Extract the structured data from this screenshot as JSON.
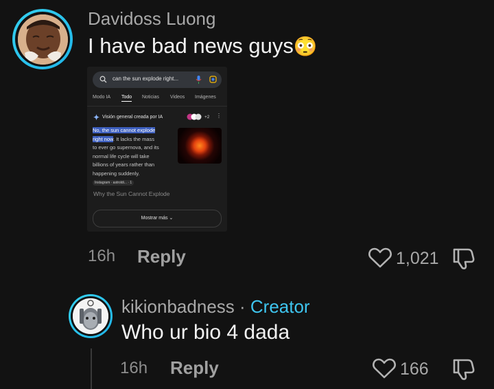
{
  "comment": {
    "username": "Davidoss Luong",
    "text": "I have bad news guys",
    "emoji": "😳",
    "time": "16h",
    "reply_label": "Reply",
    "likes": "1,021"
  },
  "embedded_screenshot": {
    "search_query": "can the sun explode right...",
    "tabs": [
      "Modo IA",
      "Todo",
      "Noticias",
      "Videos",
      "Imágenes"
    ],
    "active_tab": "Todo",
    "ai_header": "Visión general creada por IA",
    "source_count": "+2",
    "highlight_text_1": "No, the sun cannot explode",
    "highlight_text_2": "right now",
    "body_text_1": ". It lacks the mass",
    "body_text_2": "to ever go supernova, and its",
    "body_text_3": "normal life cycle will take",
    "body_text_4": "billions of years rather than",
    "body_text_5": "happening suddenly.",
    "source_chip": "Instagram · astroldi... · 1",
    "why_heading": "Why the Sun Cannot Explode",
    "show_more": "Mostrar más"
  },
  "reply": {
    "username": "kikionbadness",
    "separator": " · ",
    "creator_label": "Creator",
    "text": "Who ur bio 4 dada",
    "time": "16h",
    "reply_label": "Reply",
    "likes": "166"
  },
  "colors": {
    "background": "#121212",
    "accent": "#3ec5ef",
    "highlight": "#3d5fbf"
  }
}
